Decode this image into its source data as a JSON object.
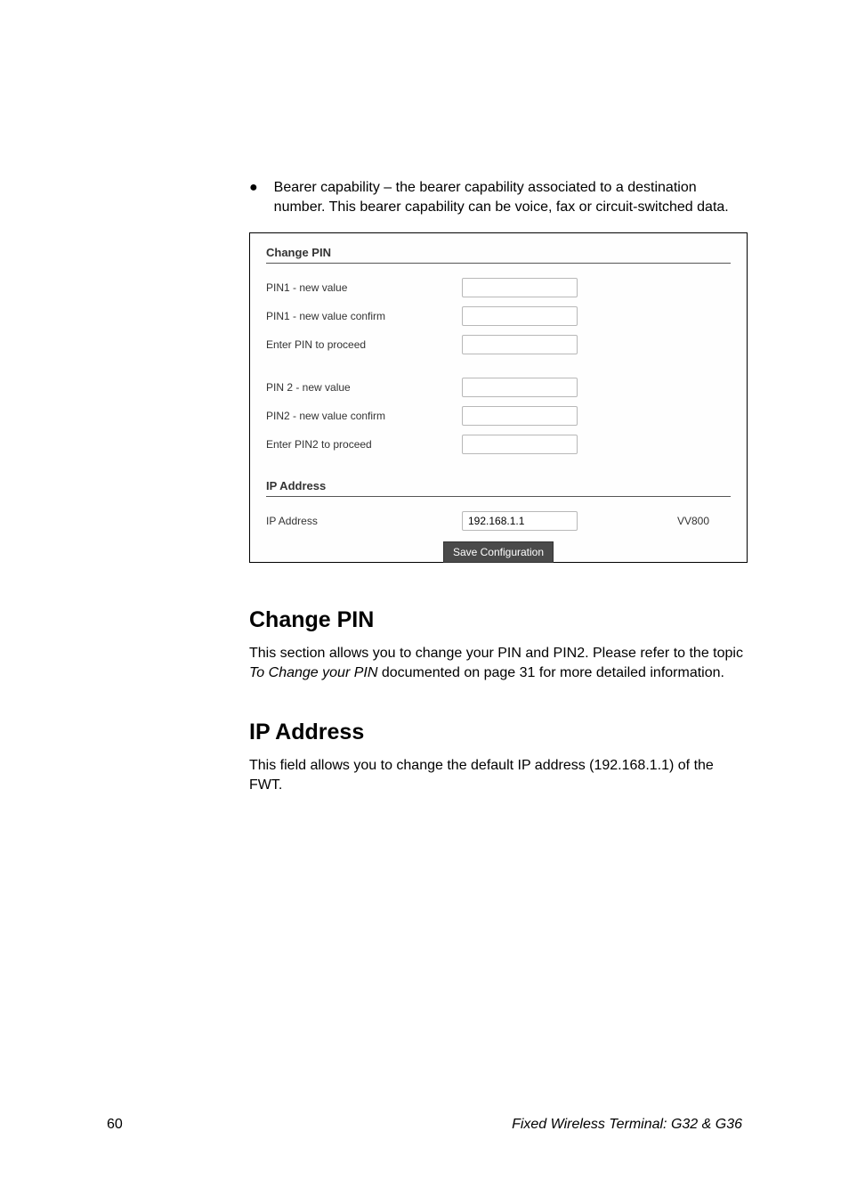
{
  "bullet": {
    "text": "Bearer capability – the bearer capability associated to a destination number. This bearer capability can be voice, fax or circuit-switched data."
  },
  "form": {
    "changePinTitle": "Change PIN",
    "pin1New": "PIN1 - new value",
    "pin1Confirm": "PIN1 - new value confirm",
    "pin1Proceed": "Enter PIN to proceed",
    "pin2New": "PIN 2 - new value",
    "pin2Confirm": "PIN2 - new value confirm",
    "pin2Proceed": "Enter PIN2 to proceed",
    "ipAddressTitle": "IP Address",
    "ipAddressLabel": "IP Address",
    "ipAddressValue": "192.168.1.1",
    "rightCode": "VV800",
    "saveButton": "Save Configuration"
  },
  "section1": {
    "heading": "Change PIN",
    "p_a": "This section allows you to change your PIN and PIN2.  Please refer to the topic ",
    "p_italic": "To Change your PIN",
    "p_b": " documented on page 31 for more detailed information."
  },
  "section2": {
    "heading": "IP Address",
    "p": "This field allows you to change the default IP address (192.168.1.1) of the FWT."
  },
  "footer": {
    "pageNum": "60",
    "title": "Fixed Wireless Terminal: G32 & G36"
  }
}
